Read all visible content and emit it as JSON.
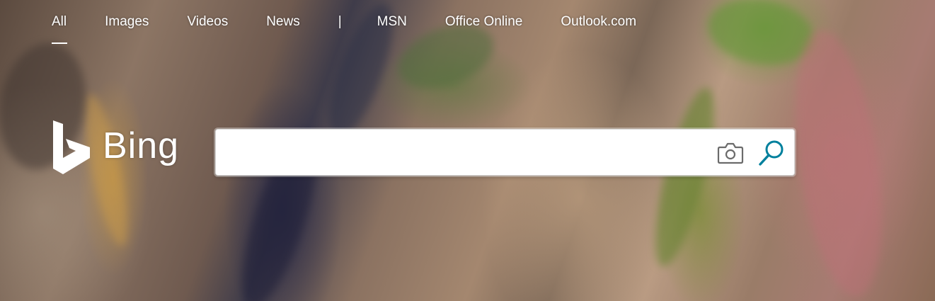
{
  "nav": {
    "items": [
      {
        "label": "All",
        "active": true
      },
      {
        "label": "Images",
        "active": false
      },
      {
        "label": "Videos",
        "active": false
      },
      {
        "label": "News",
        "active": false
      }
    ],
    "separator": "|",
    "links": [
      {
        "label": "MSN"
      },
      {
        "label": "Office Online"
      },
      {
        "label": "Outlook.com"
      }
    ]
  },
  "brand": {
    "name": "Bing",
    "logo_icon": "bing-b-logo-icon"
  },
  "search": {
    "value": "",
    "placeholder": "",
    "camera_icon": "camera-icon",
    "search_icon": "search-icon",
    "accent_color": "#00809d"
  }
}
